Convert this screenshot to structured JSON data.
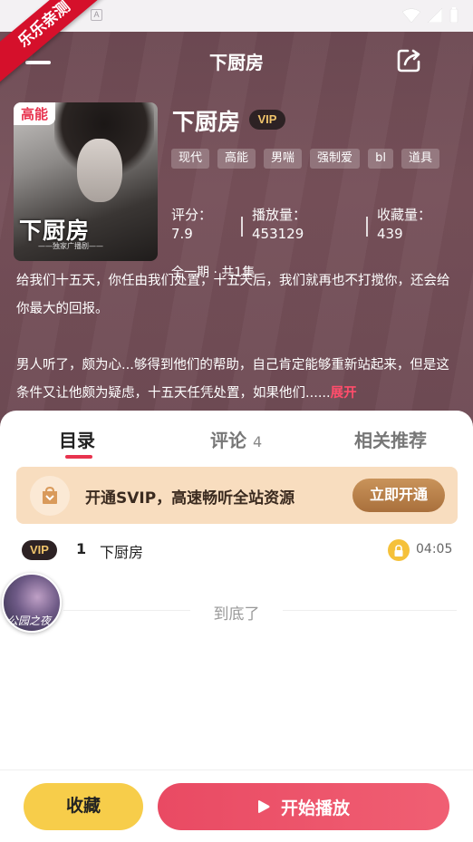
{
  "ribbon": "乐乐亲测",
  "nav": {
    "title": "下厨房"
  },
  "book": {
    "cover_badge": "高能",
    "cover_title": "下厨房",
    "cover_subtitle": "——独家广播剧——",
    "title": "下厨房",
    "vip": "VIP",
    "tags": [
      "现代",
      "高能",
      "男喘",
      "强制爱",
      "bl",
      "道具"
    ],
    "stats": {
      "rating_label": "评分：",
      "rating_value": "7.9",
      "plays_label": "播放量：",
      "plays_value": "453129",
      "favs_label": "收藏量：",
      "favs_value": "439"
    },
    "episodes": "全一期 · 共1集",
    "desc_p1": "给我们十五天，你任由我们处置，十五天后，我们就再也不打搅你，还会给你最大的回报。",
    "desc_p2": "男人听了，颇为心...够得到他们的帮助，自己肯定能够重新站起来，但是这条件又让他颇为疑虑，十五天任凭处置，如果他们......",
    "expand": "展开"
  },
  "tabs": {
    "catalog": "目录",
    "comments": "评论",
    "comments_count": "4",
    "related": "相关推荐"
  },
  "promo": {
    "text": "开通SVIP，高速畅听全站资源",
    "button": "立即开通"
  },
  "episode_list": [
    {
      "vip": "VIP",
      "number": "1",
      "title": "下厨房",
      "duration": "04:05"
    }
  ],
  "end_text": "到底了",
  "float_avatar_text": "公园之夜",
  "bottom": {
    "favorite": "收藏",
    "play": "开始播放"
  }
}
